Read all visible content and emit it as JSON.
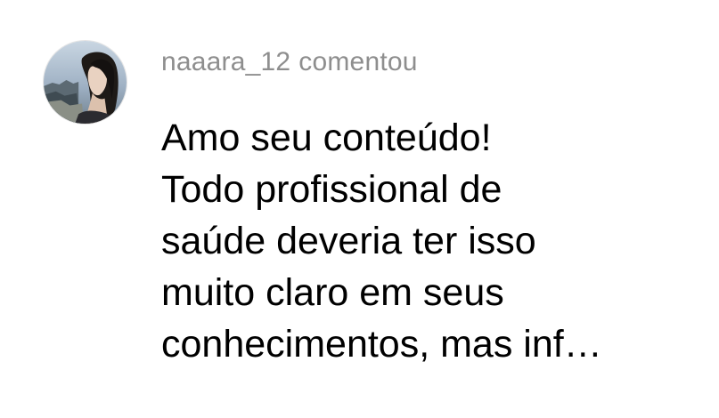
{
  "comment": {
    "username": "naaara_12",
    "action": "comentou",
    "text": "Amo seu conteúdo!\nTodo profissional de\nsaúde deveria ter isso\nmuito claro em seus\nconhecimentos, mas inf…",
    "avatar": {
      "icon": "user-photo-avatar",
      "description_colors": {
        "sky": "#a9b9c9",
        "hair": "#1e1a17",
        "skin": "#e9d2c1"
      }
    }
  },
  "colors": {
    "background": "#ffffff",
    "username": "#8e8e8e",
    "text": "#000000"
  }
}
